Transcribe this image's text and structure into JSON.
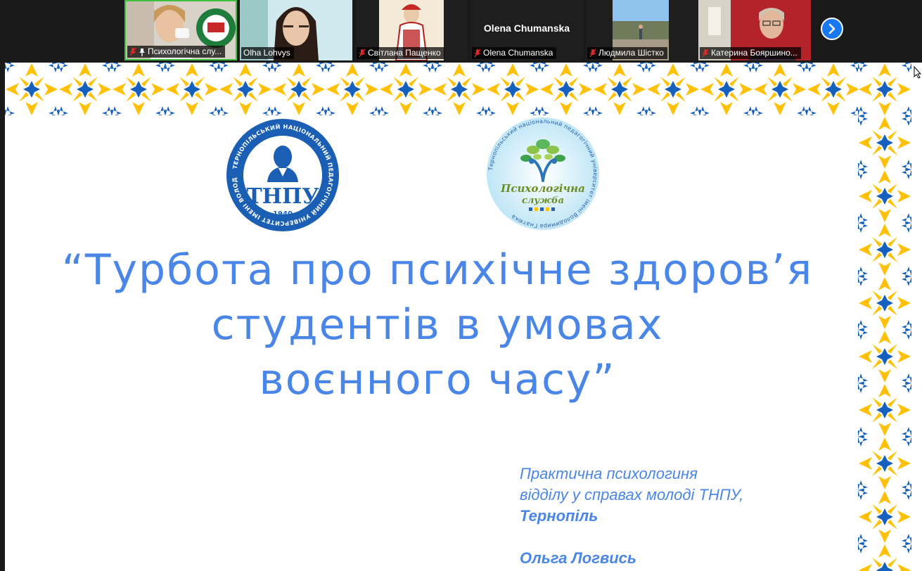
{
  "participants": [
    {
      "name": "Психологічна слу...",
      "muted": true,
      "pinned": true,
      "active": true,
      "video": "logo"
    },
    {
      "name": "Olha Lohvys",
      "muted": false,
      "pinned": false,
      "active": false,
      "video": "face"
    },
    {
      "name": "Світлана Пащенко",
      "muted": true,
      "pinned": false,
      "active": false,
      "video": "costume"
    },
    {
      "name": "Olena Chumanska",
      "muted": true,
      "pinned": false,
      "active": false,
      "video": "none",
      "center_label": "Olena Chumanska"
    },
    {
      "name": "Людмила Шістко",
      "muted": true,
      "pinned": false,
      "active": false,
      "video": "outdoor"
    },
    {
      "name": "Катерина Бояршино...",
      "muted": true,
      "pinned": false,
      "active": false,
      "video": "face2"
    }
  ],
  "icons": {
    "next": "chevron-right-icon",
    "mic": "mic-muted-icon",
    "pin": "pin-icon",
    "cursor": "mouse-cursor-icon"
  },
  "colors": {
    "ornament_blue": "#1560bd",
    "ornament_yellow": "#ffc107",
    "title_blue": "#4a86e8",
    "active_border": "#3fbf3f",
    "next_button": "#1877f2",
    "muted_red": "#e02828"
  },
  "slide": {
    "logo_left": {
      "ring_text": "ТЕРНОПІЛЬСЬКИЙ НАЦІОНАЛЬНИЙ ПЕДАГОГІЧНИЙ УНІВЕРСИТЕТ ІМЕНІ ВОЛОДИМИРА ГНАТЮКА",
      "abbr": "ТНПУ",
      "year": "1940"
    },
    "logo_right": {
      "ring_text": "Тернопільський національний педагогічний університет імені Володимира Гнатюка",
      "line1": "Психологічна",
      "line2": "служба"
    },
    "title_lines": [
      "“Турбота про психічне здоров’я",
      "студентів в умовах",
      "воєнного часу”"
    ],
    "author_lines": [
      "Практична психологиня",
      "відділу у справах молоді ТНПУ,",
      "Тернопіль",
      "",
      "Ольга Логвись"
    ]
  }
}
